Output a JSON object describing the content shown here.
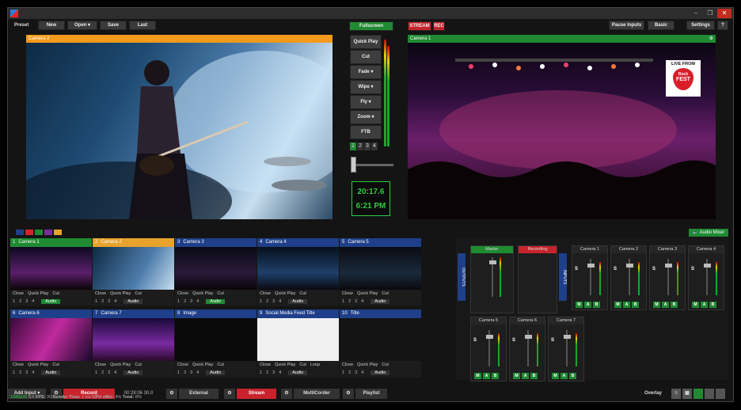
{
  "toolbar": {
    "preset": "Preset",
    "new": "New",
    "open": "Open",
    "save": "Save",
    "last": "Last",
    "fullscreen": "Fullscreen",
    "stream": "STREAM",
    "rec": "REC",
    "pause_inputs": "Pause Inputs",
    "basic": "Basic",
    "settings": "Settings",
    "help": "?"
  },
  "preview": {
    "title": "Camera 2"
  },
  "output": {
    "title": "Camera 1",
    "logo_line1": "LIVE FROM",
    "logo_line2": "Rock",
    "logo_line3": "FEST"
  },
  "transitions": {
    "quick_play": "Quick Play",
    "cut": "Cut",
    "fade": "Fade",
    "wipe": "Wipe",
    "fly": "Fly",
    "zoom": "Zoom",
    "ftb": "FTB",
    "pages": [
      "1",
      "2",
      "3",
      "4"
    ],
    "timer": "20:17.6",
    "clock": "6:21 PM"
  },
  "inputs": [
    {
      "num": "1",
      "name": "Camera 1",
      "header_color": "#1f8a32"
    },
    {
      "num": "2",
      "name": "Camera 2",
      "header_color": "#e8a32c"
    },
    {
      "num": "3",
      "name": "Camera 3",
      "header_color": "#1f3f8a"
    },
    {
      "num": "4",
      "name": "Camera 4",
      "header_color": "#1f3f8a"
    },
    {
      "num": "5",
      "name": "Camera 5",
      "header_color": "#1f3f8a"
    },
    {
      "num": "6",
      "name": "Camera 6",
      "header_color": "#1f3f8a"
    },
    {
      "num": "7",
      "name": "Camera 7",
      "header_color": "#1f3f8a"
    },
    {
      "num": "8",
      "name": "Image",
      "header_color": "#1f3f8a"
    },
    {
      "num": "9",
      "name": "Social Media Feed Title",
      "header_color": "#1f3f8a"
    },
    {
      "num": "10",
      "name": "Title",
      "header_color": "#1f3f8a"
    }
  ],
  "input_controls": {
    "close": "Close",
    "quick_play": "Quick Play",
    "cut": "Cut",
    "loop": "Loop",
    "audio": "Audio",
    "nums": [
      "1",
      "2",
      "3",
      "4"
    ]
  },
  "mixer": {
    "label": "Audio Mixer",
    "outputs_label": "OUTPUTS",
    "inputs_label": "INPUTS",
    "master": "Master",
    "recording": "Recording",
    "channels": [
      "Camera 1",
      "Camera 2",
      "Camera 3",
      "Camera 4",
      "Camera 5",
      "Camera 6",
      "Camera 7"
    ],
    "m": "M",
    "a": "A",
    "b": "B",
    "s": "S"
  },
  "bottom": {
    "add_input": "Add Input",
    "record": "Record",
    "rec_time": "00:28:06 30.0",
    "external": "External",
    "stream": "Stream",
    "multicorder": "MultiCorder",
    "playlist": "Playlist",
    "overlay": "Overlay"
  },
  "status": {
    "format": "1080p30",
    "ex": "EX",
    "fps_label": "FPS:",
    "fps": "30",
    "render_label": "Render Time:",
    "render": "1 ms",
    "cpu_label": "CPU vMix:",
    "cpu": "4%",
    "total_label": "Total:",
    "total": "8%"
  }
}
